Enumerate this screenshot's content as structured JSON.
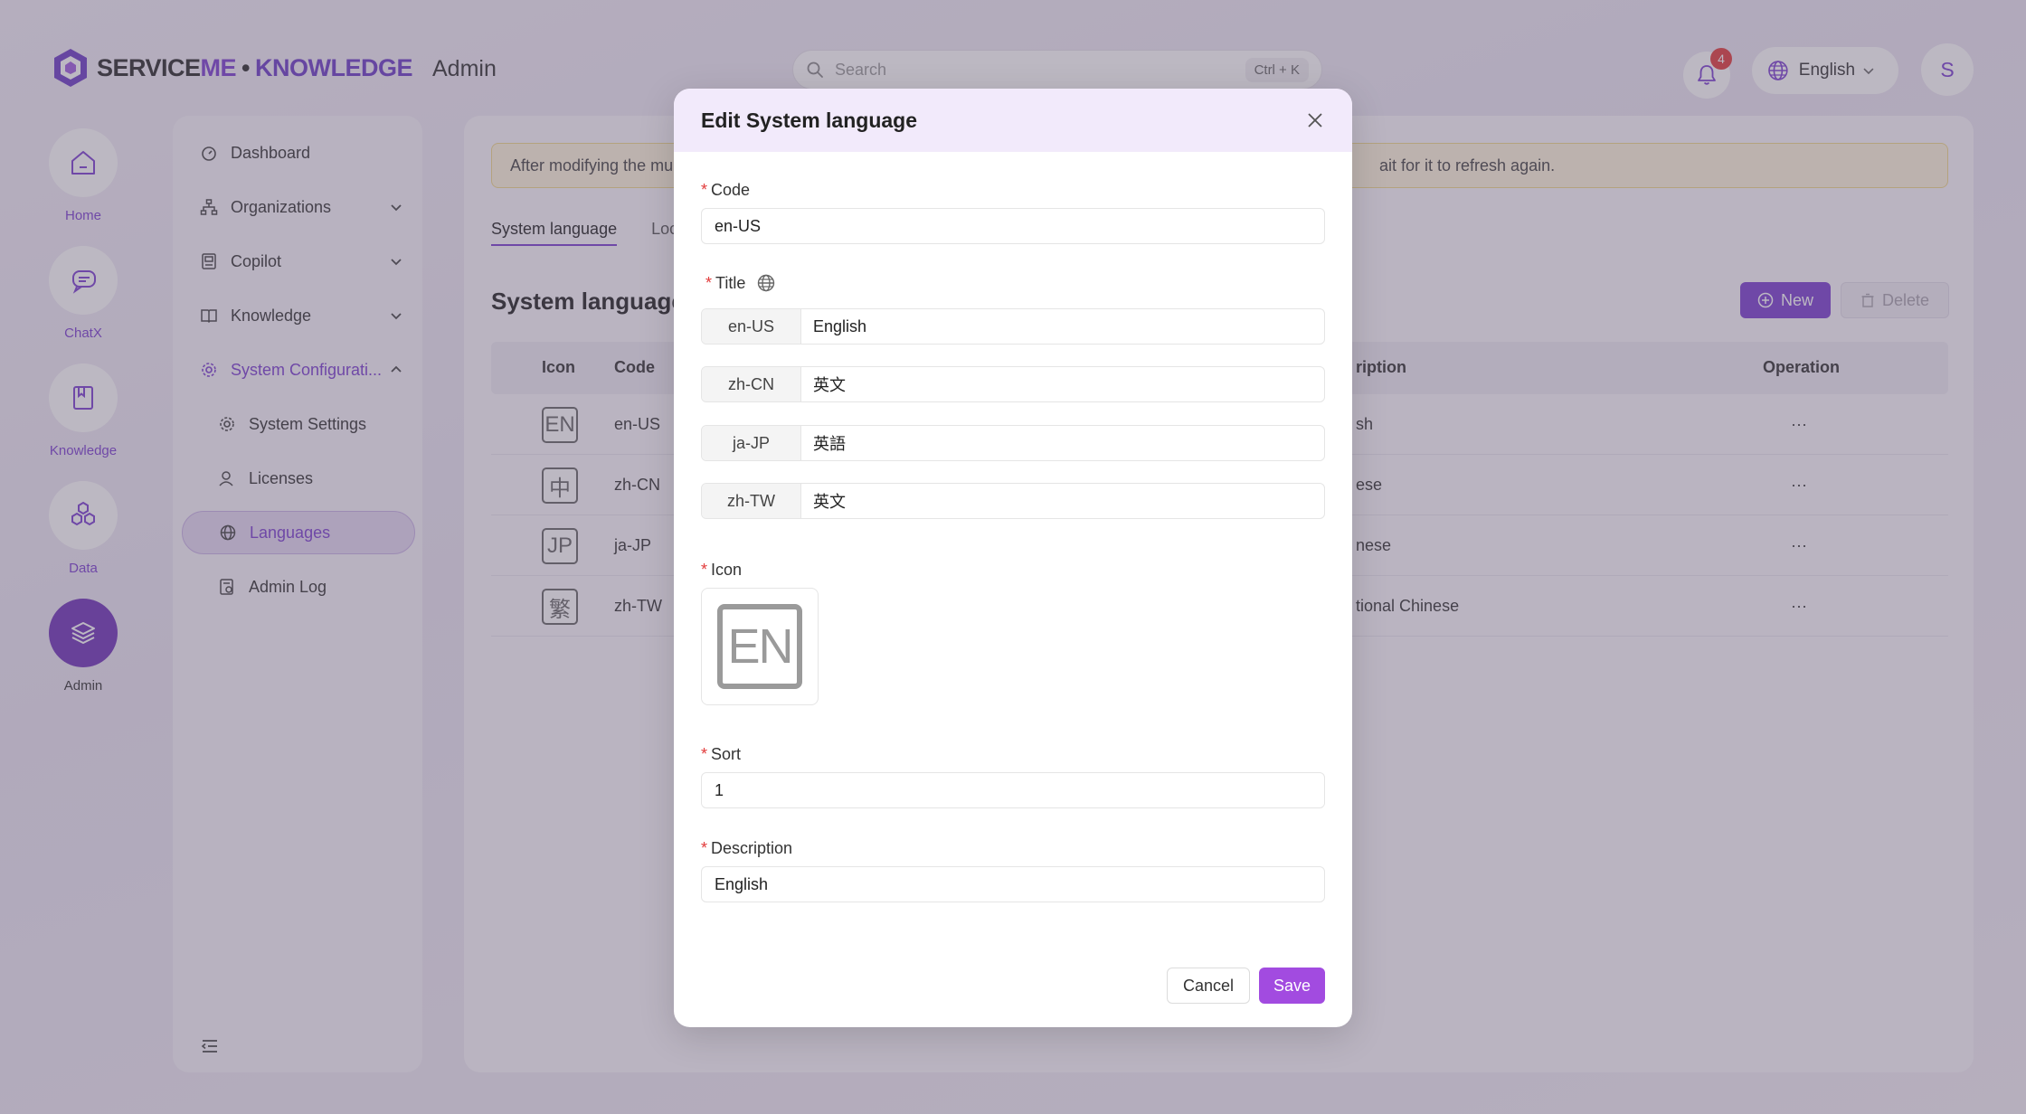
{
  "header": {
    "brand_part1": "SERVICE",
    "brand_part2": "ME",
    "brand_sep": "•",
    "brand_part3": "KNOWLEDGE",
    "app_title": "Admin",
    "search_placeholder": "Search",
    "search_shortcut": "Ctrl + K",
    "notification_count": "4",
    "language": "English",
    "avatar_initial": "S"
  },
  "rail": {
    "home": "Home",
    "chatx": "ChatX",
    "knowledge": "Knowledge",
    "data": "Data",
    "admin": "Admin"
  },
  "sidebar": {
    "dashboard": "Dashboard",
    "organizations": "Organizations",
    "copilot": "Copilot",
    "knowledge": "Knowledge",
    "system_configuration": "System Configurati...",
    "system_settings": "System Settings",
    "licenses": "Licenses",
    "languages": "Languages",
    "admin_log": "Admin Log"
  },
  "main": {
    "notice_start": "After modifying the mu",
    "notice_end": "ait for it to refresh again.",
    "tabs": [
      "System language",
      "Loc"
    ],
    "section_title": "System language",
    "new_button": "New",
    "delete_button": "Delete",
    "columns": {
      "icon": "Icon",
      "code": "Code",
      "description": "ription",
      "operation": "Operation"
    },
    "rows": [
      {
        "icon": "EN",
        "code": "en-US",
        "description": "sh",
        "operation": "···"
      },
      {
        "icon": "中",
        "code": "zh-CN",
        "description": "ese",
        "operation": "···"
      },
      {
        "icon": "JP",
        "code": "ja-JP",
        "description": "nese",
        "operation": "···"
      },
      {
        "icon": "繁",
        "code": "zh-TW",
        "description": "tional Chinese",
        "operation": "···"
      }
    ]
  },
  "modal": {
    "title": "Edit System language",
    "code_label": "Code",
    "code_value": "en-US",
    "title_label": "Title",
    "titles": [
      {
        "locale": "en-US",
        "value": "English"
      },
      {
        "locale": "zh-CN",
        "value": "英文"
      },
      {
        "locale": "ja-JP",
        "value": "英語"
      },
      {
        "locale": "zh-TW",
        "value": "英文"
      }
    ],
    "icon_label": "Icon",
    "icon_preview": "EN",
    "sort_label": "Sort",
    "sort_value": "1",
    "description_label": "Description",
    "description_value": "English",
    "cancel_button": "Cancel",
    "save_button": "Save",
    "required_mark": "*"
  },
  "colors": {
    "accent": "#7b3fd0",
    "save_button": "#a24be0",
    "required": "#e23b3b",
    "notice_bg": "#fff5dc"
  }
}
